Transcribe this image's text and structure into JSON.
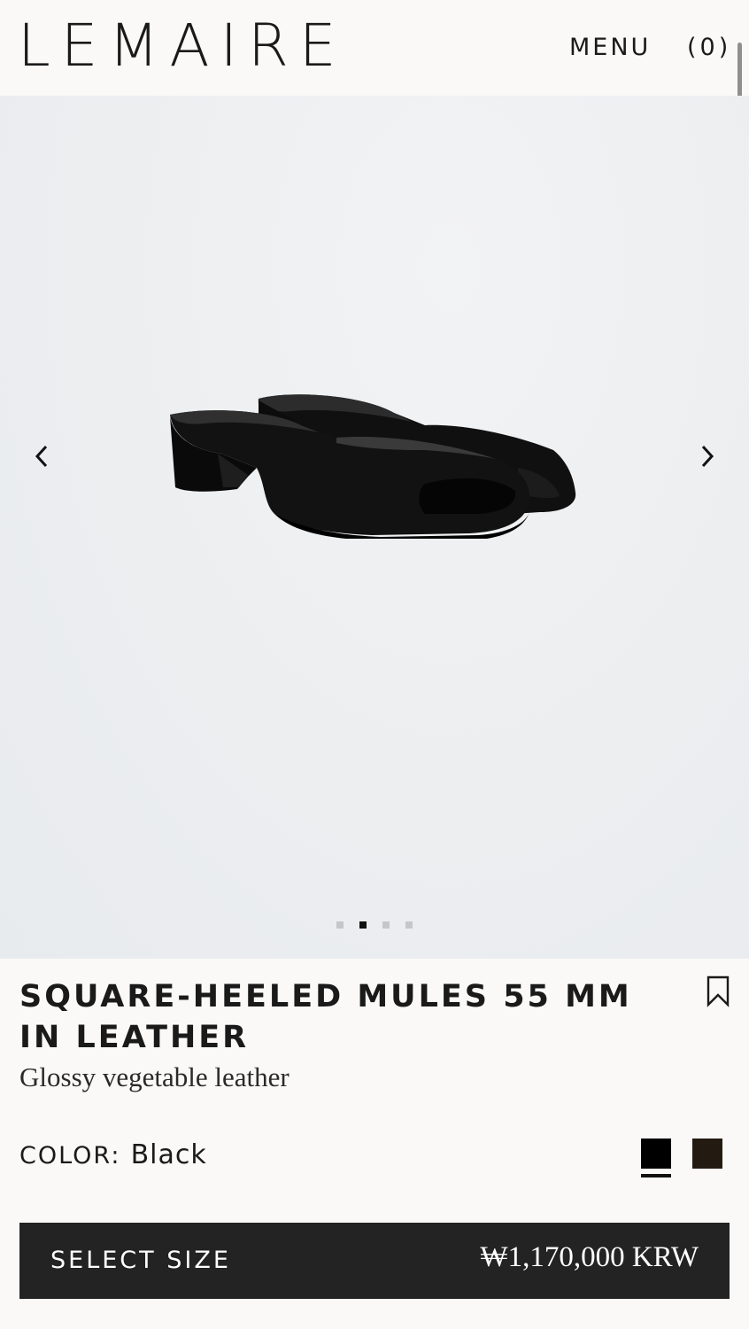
{
  "header": {
    "logo": "LEMAIRE",
    "menu_label": "MENU",
    "cart_label": "(0)"
  },
  "gallery": {
    "image_alt": "Black square-heeled leather mules",
    "slide_count": 4,
    "active_slide": 2
  },
  "product": {
    "title": "SQUARE-HEELED MULES 55 MM IN LEATHER",
    "subtitle": "Glossy vegetable leather",
    "color_label": "COLOR:",
    "color_value": "Black",
    "swatches": [
      {
        "name": "Black",
        "hex": "#000000",
        "selected": true
      },
      {
        "name": "Brown",
        "hex": "#231a12",
        "selected": false
      }
    ]
  },
  "cta": {
    "label": "SELECT SIZE",
    "price": "₩1,170,000 KRW"
  },
  "colors": {
    "background": "#faf9f7",
    "gallery_bg": "#eceef0",
    "button_bg": "#232323",
    "text": "#1a1a1a"
  }
}
